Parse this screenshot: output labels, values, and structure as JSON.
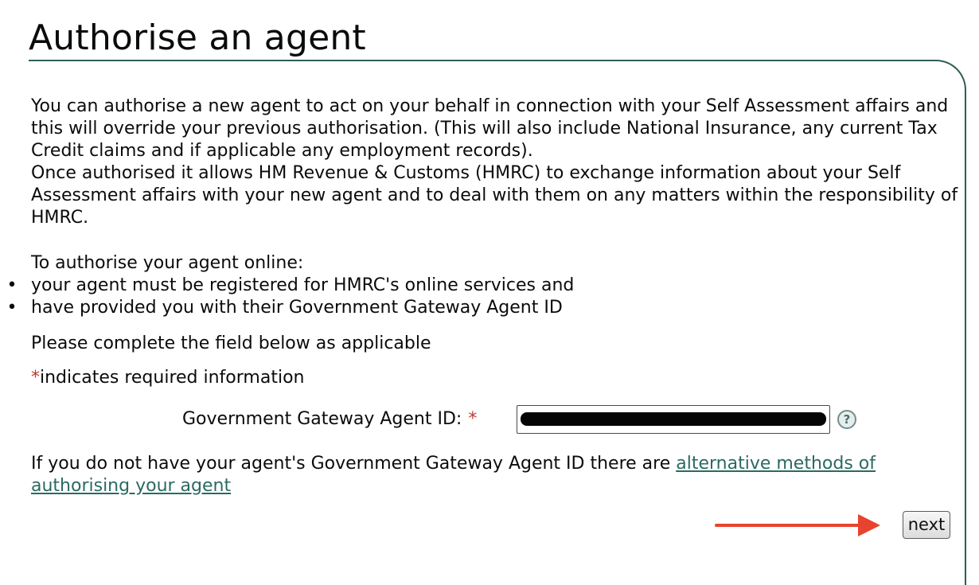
{
  "page": {
    "title": "Authorise an agent"
  },
  "intro": {
    "paragraph": "You can authorise a new agent to act on your behalf in connection with your Self Assessment affairs and this will override your previous authorisation. (This will also include National Insurance, any current Tax Credit claims and if applicable any employment records).",
    "paragraph_2": "Once authorised it allows HM Revenue & Customs (HMRC) to exchange information about your Self Assessment affairs with your new agent and to deal with them on any matters within the responsibility of HMRC."
  },
  "online": {
    "heading": "To authorise your agent online:",
    "requirements": [
      "your agent must be registered for HMRC's online services and",
      "have provided you with their Government Gateway Agent ID"
    ],
    "bullet": "•"
  },
  "form": {
    "instruction": "Please complete the field below as applicable",
    "required_marker": "*",
    "required_note": "indicates required information",
    "agent_id_label": "Government Gateway Agent ID:",
    "help_glyph": "?"
  },
  "alternatives": {
    "text": "If you do not have your agent's Government Gateway Agent ID there are ",
    "link_label": "alternative methods of authorising your agent"
  },
  "actions": {
    "next_label": "next"
  },
  "colors": {
    "accent": "#2f5e57",
    "link": "#2a6a62",
    "required": "#c0392b",
    "arrow": "#e8432e"
  }
}
